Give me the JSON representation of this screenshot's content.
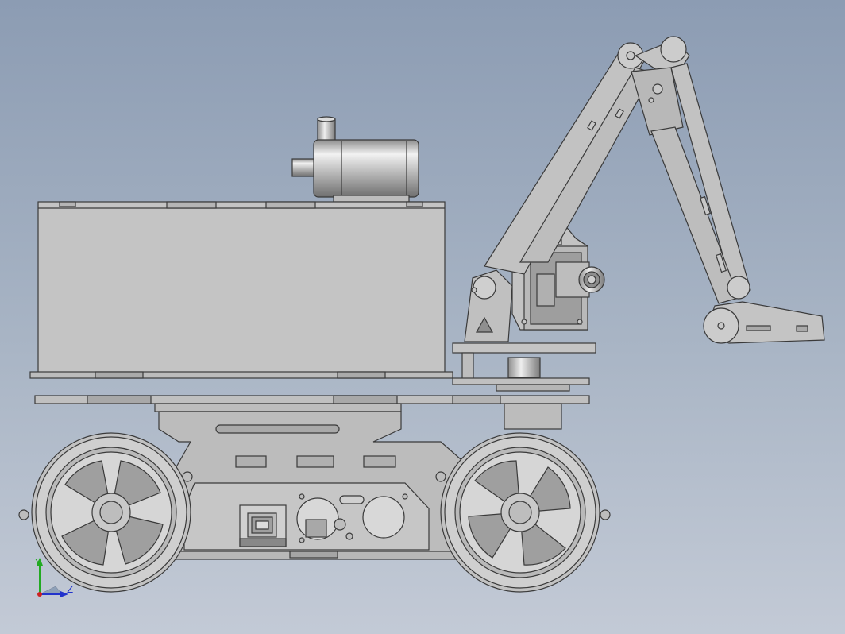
{
  "view": {
    "background_top": "#8c9cb3",
    "background_bottom": "#c3cad6",
    "part_fill": "#c8c8c8",
    "part_stroke": "#3a3a3a"
  },
  "triad": {
    "y_label": "Y",
    "z_label": "Z",
    "y_color": "#22aa22",
    "z_color": "#2233cc",
    "x_color": "#cc2222"
  }
}
